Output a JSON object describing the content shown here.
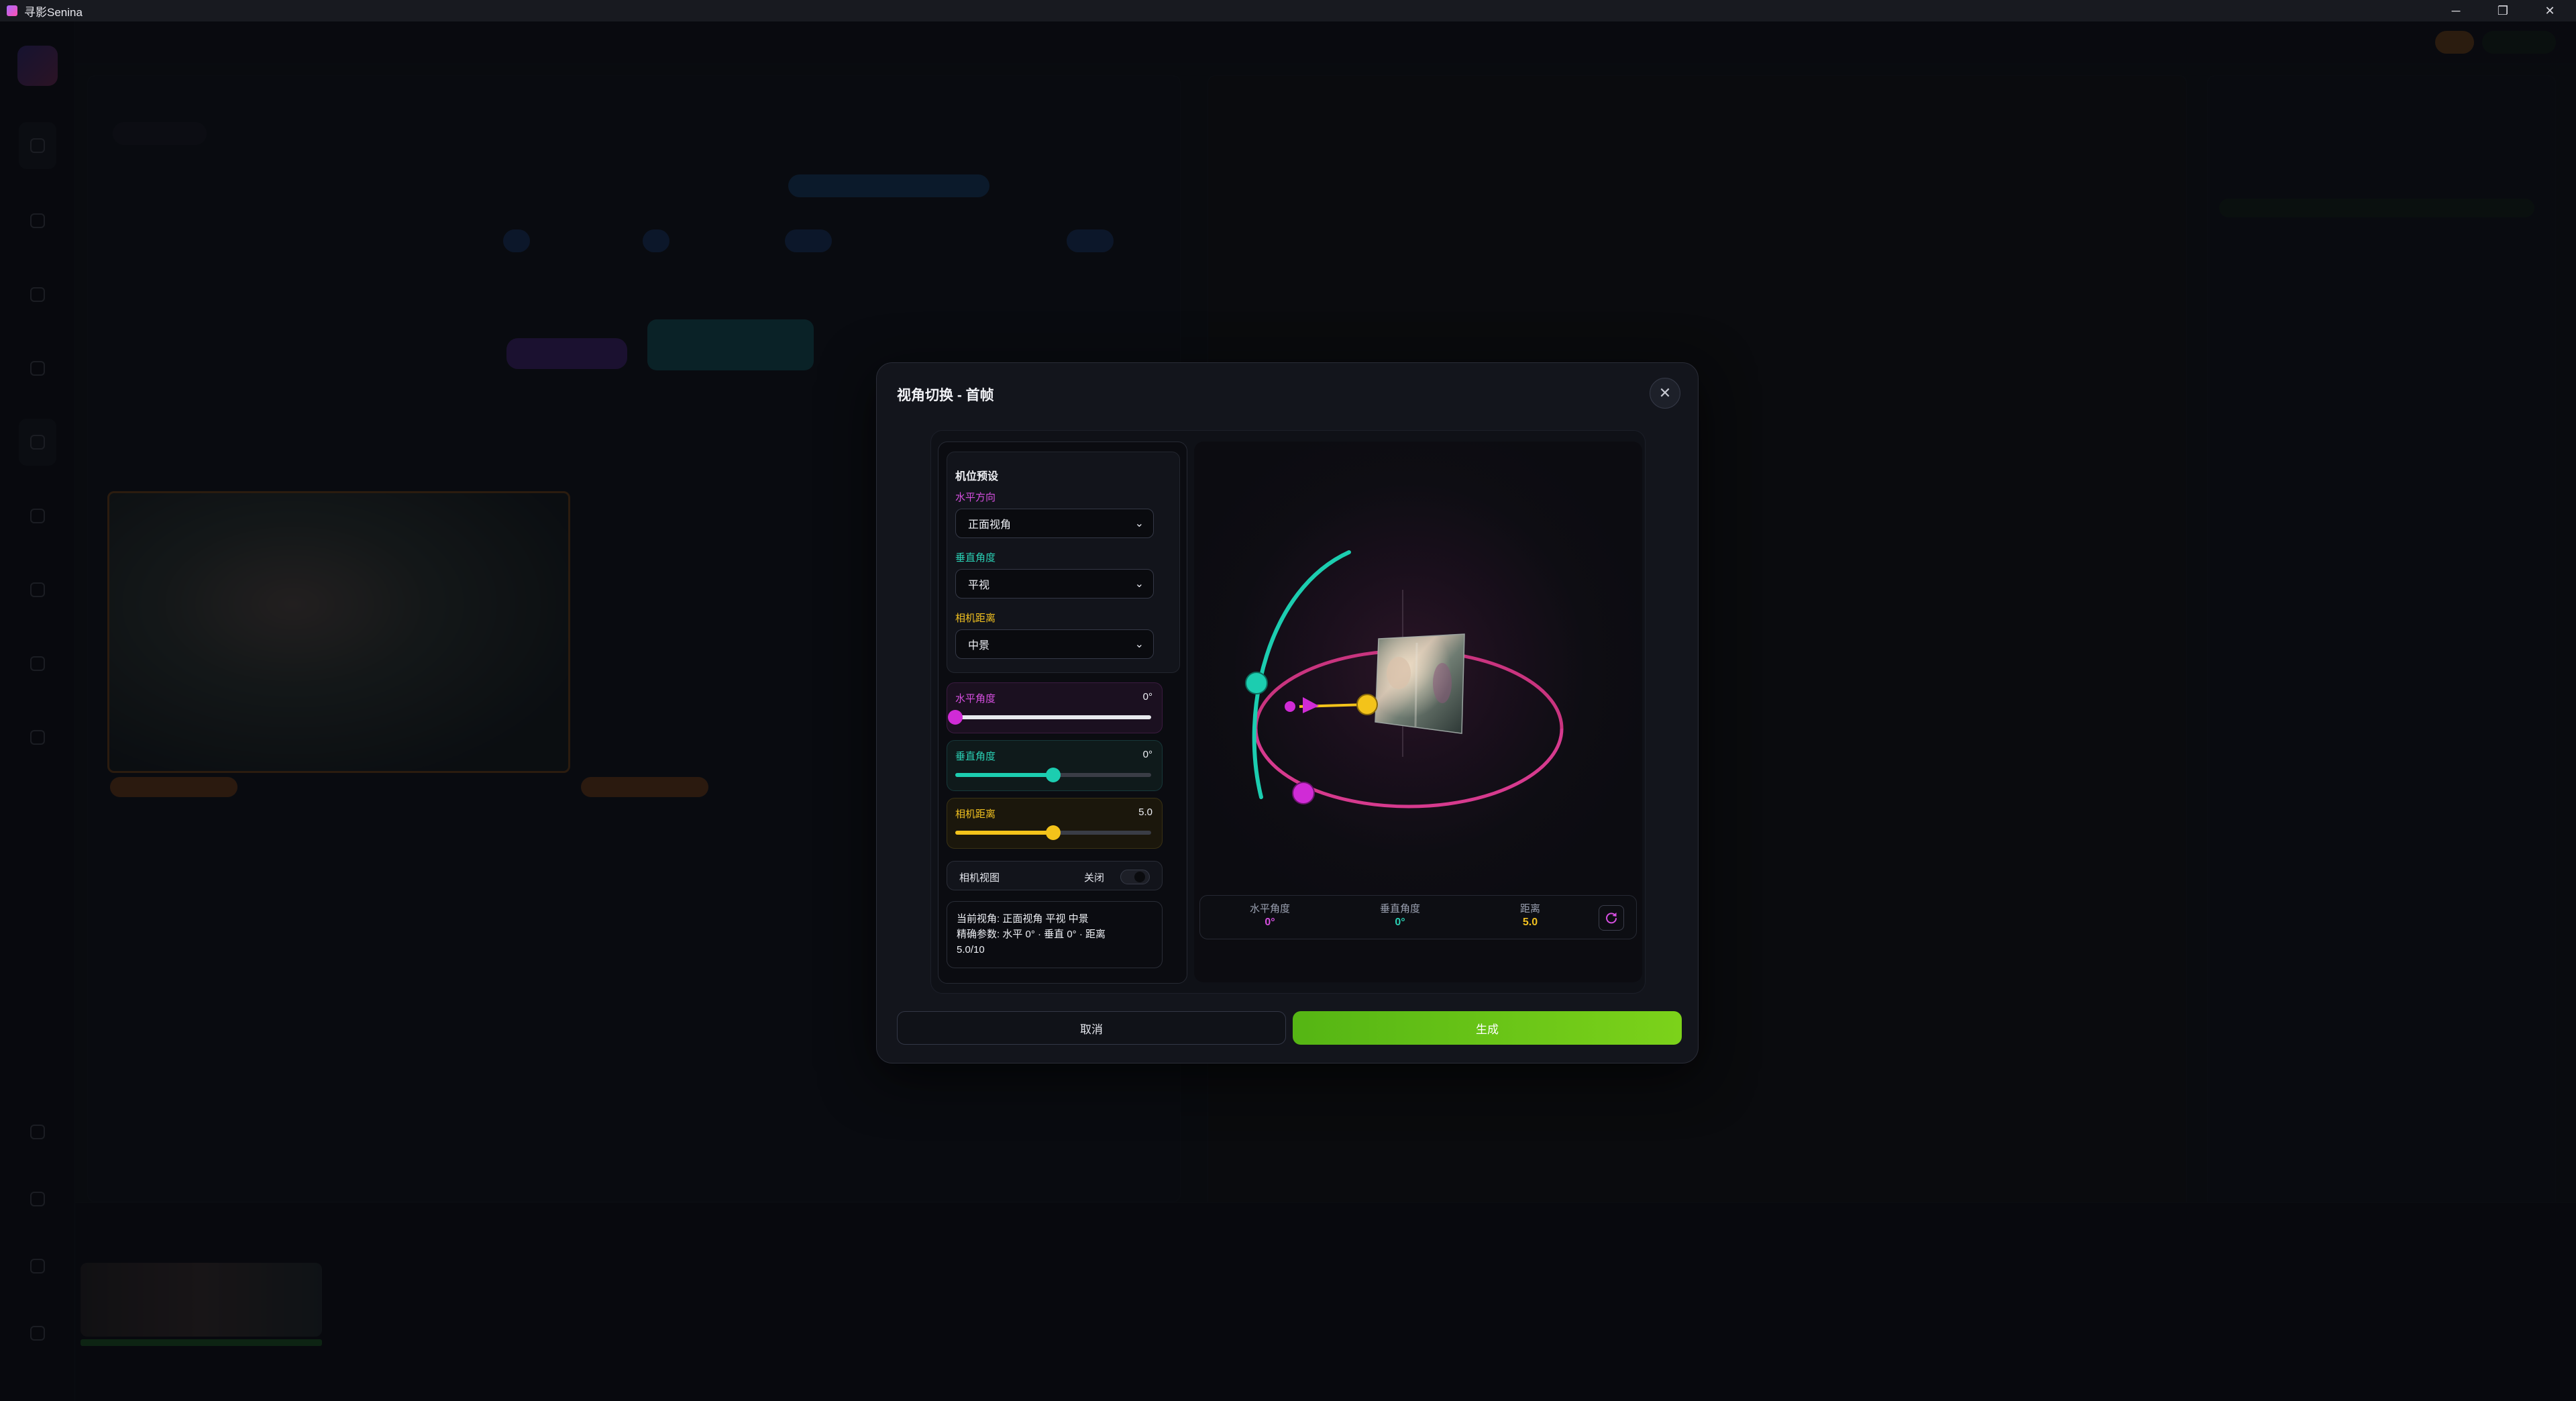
{
  "window": {
    "title": "寻影Senina",
    "minimize": "─",
    "maximize": "❐",
    "close": "✕"
  },
  "dialog": {
    "title": "视角切换 - 首帧",
    "close_icon": "✕",
    "cancel_label": "取消",
    "generate_label": "生成"
  },
  "camera_presets": {
    "heading": "机位预设",
    "horizontal": {
      "label": "水平方向",
      "value": "正面视角"
    },
    "vertical": {
      "label": "垂直角度",
      "value": "平视"
    },
    "distance": {
      "label": "相机距离",
      "value": "中景"
    }
  },
  "sliders": {
    "horizontal": {
      "label": "水平角度",
      "display": "0°",
      "value": 0,
      "min": 0,
      "max": 360,
      "color": "#d02bd6"
    },
    "vertical": {
      "label": "垂直角度",
      "display": "0°",
      "value": 0,
      "min": -90,
      "max": 90,
      "color": "#1ccdb0"
    },
    "distance": {
      "label": "相机距离",
      "display": "5.0",
      "value": 5.0,
      "min": 0,
      "max": 10,
      "color": "#f3c31a"
    }
  },
  "camera_view": {
    "label": "相机视图",
    "state": "关闭",
    "enabled": false
  },
  "info": {
    "line1": "当前视角: 正面视角 平视 中景",
    "line2": "精确参数: 水平 0° · 垂直 0° · 距离",
    "line3": "5.0/10"
  },
  "readout": {
    "horizontal": {
      "label": "水平角度",
      "value": "0°"
    },
    "vertical": {
      "label": "垂直角度",
      "value": "0°"
    },
    "distance": {
      "label": "距离",
      "value": "5.0"
    }
  },
  "colors": {
    "magenta": "#d02bd6",
    "teal": "#1ccdb0",
    "gold": "#f3c31a",
    "ring": "#d63a8e",
    "generate": "#6cc41a"
  }
}
